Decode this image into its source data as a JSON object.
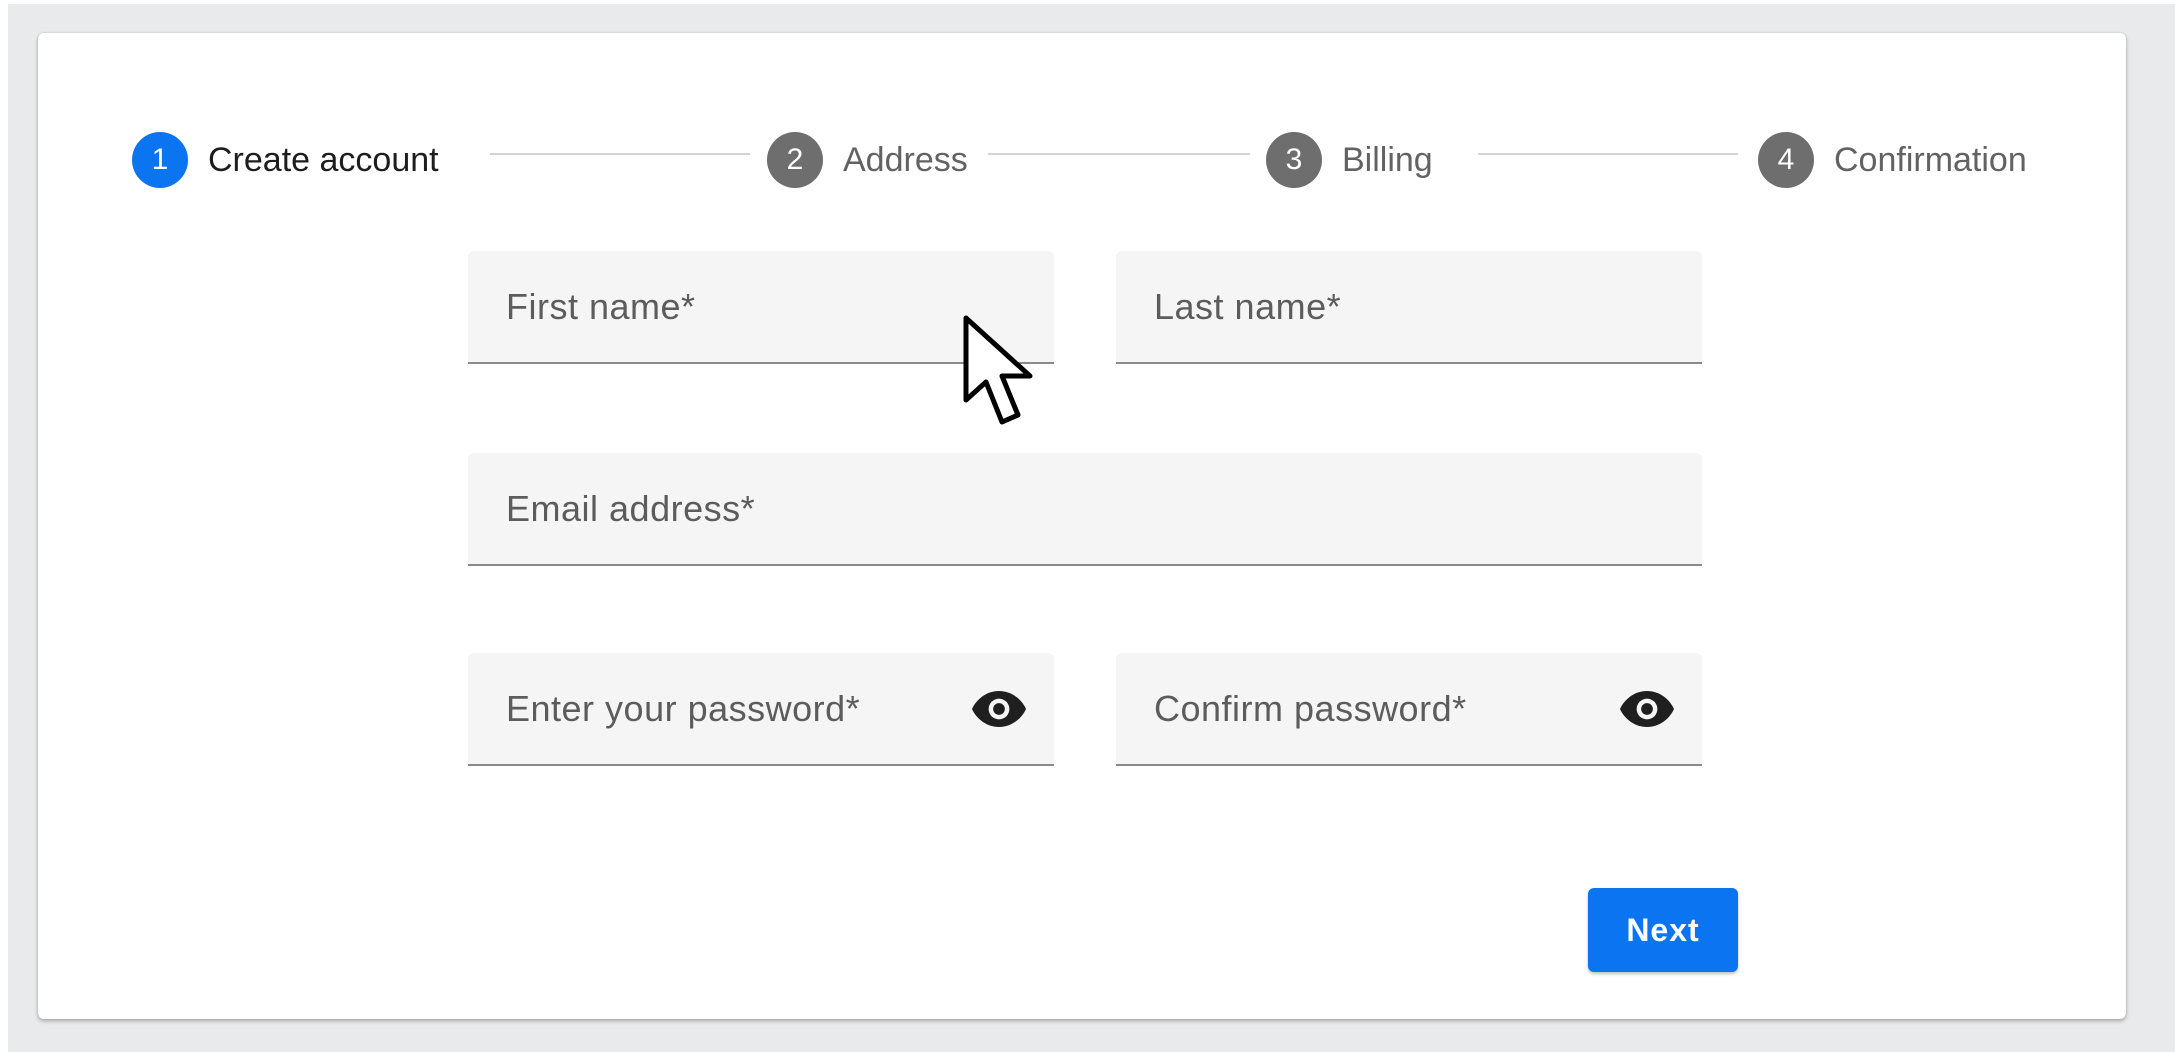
{
  "stepper": {
    "steps": [
      {
        "number": "1",
        "label": "Create account",
        "state": "active"
      },
      {
        "number": "2",
        "label": "Address",
        "state": "inactive"
      },
      {
        "number": "3",
        "label": "Billing",
        "state": "inactive"
      },
      {
        "number": "4",
        "label": "Confirmation",
        "state": "inactive"
      }
    ]
  },
  "form": {
    "first_name": {
      "placeholder": "First name*",
      "value": ""
    },
    "last_name": {
      "placeholder": "Last name*",
      "value": ""
    },
    "email": {
      "placeholder": "Email address*",
      "value": ""
    },
    "password": {
      "placeholder": "Enter your password*",
      "value": "",
      "icon": "eye-icon"
    },
    "confirm_password": {
      "placeholder": "Confirm password*",
      "value": "",
      "icon": "eye-icon"
    }
  },
  "actions": {
    "next_label": "Next"
  },
  "colors": {
    "accent": "#0b74f0",
    "step_inactive": "#6e6e6e",
    "field_background": "#f5f5f5",
    "page_background": "#e9eaec"
  }
}
